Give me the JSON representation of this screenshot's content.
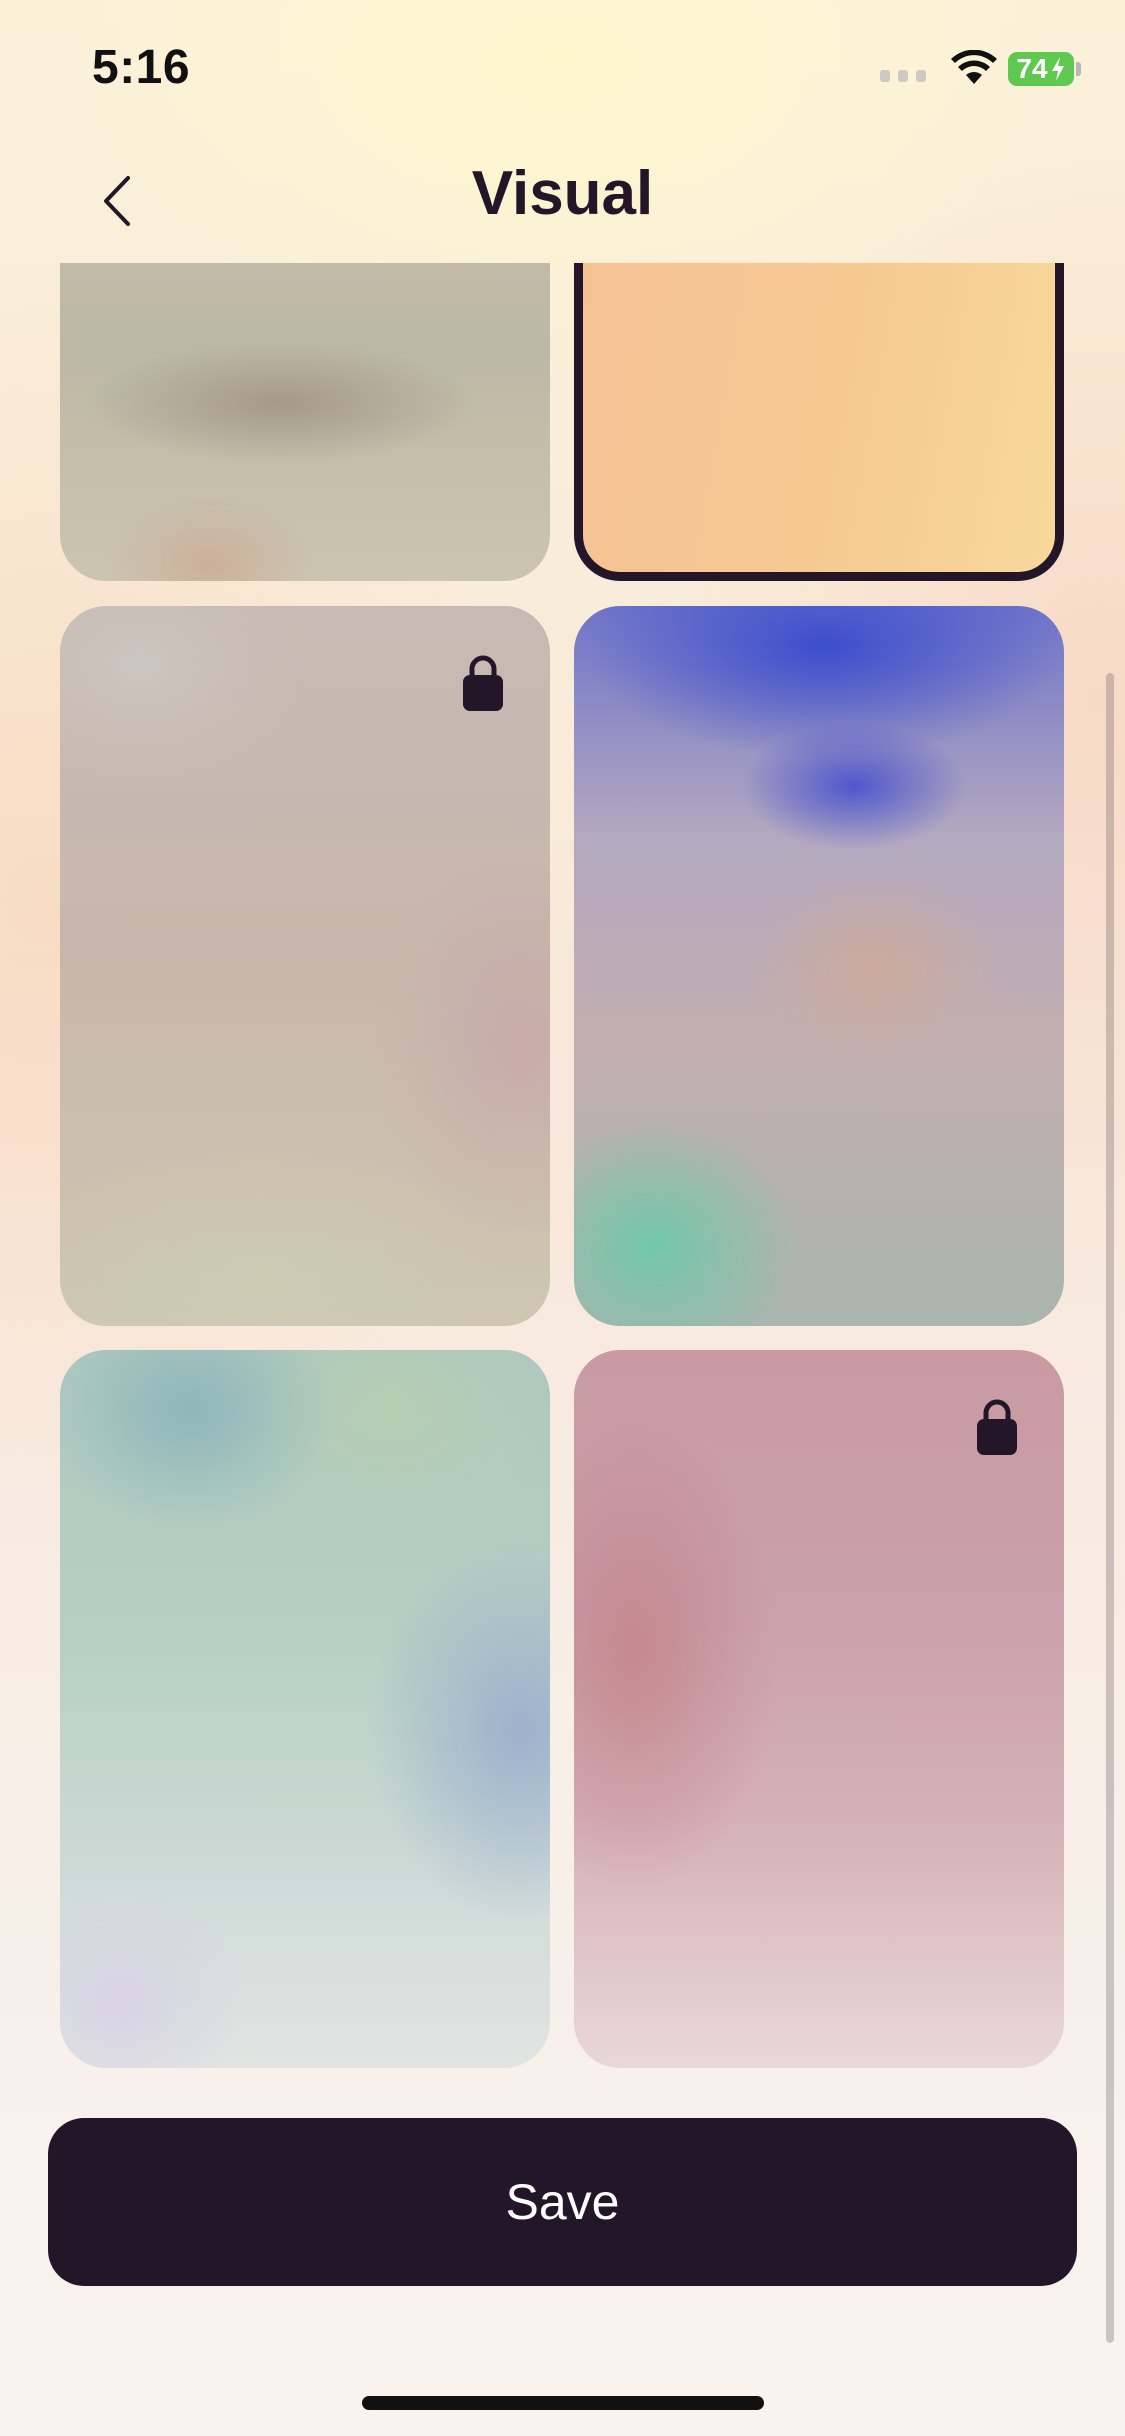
{
  "status_bar": {
    "time": "5:16",
    "battery_level": "74",
    "battery_color": "#5fc94f"
  },
  "header": {
    "title": "Visual",
    "back_icon": "chevron-left-icon"
  },
  "wallpapers": [
    {
      "id": "tile-1",
      "locked": false,
      "selected": false
    },
    {
      "id": "tile-2",
      "locked": false,
      "selected": true
    },
    {
      "id": "tile-3",
      "locked": true,
      "selected": false
    },
    {
      "id": "tile-4",
      "locked": false,
      "selected": false
    },
    {
      "id": "tile-5",
      "locked": false,
      "selected": false
    },
    {
      "id": "tile-6",
      "locked": true,
      "selected": false
    }
  ],
  "actions": {
    "save_label": "Save"
  },
  "colors": {
    "primary_dark": "#231629",
    "selected_border": "#231629"
  }
}
